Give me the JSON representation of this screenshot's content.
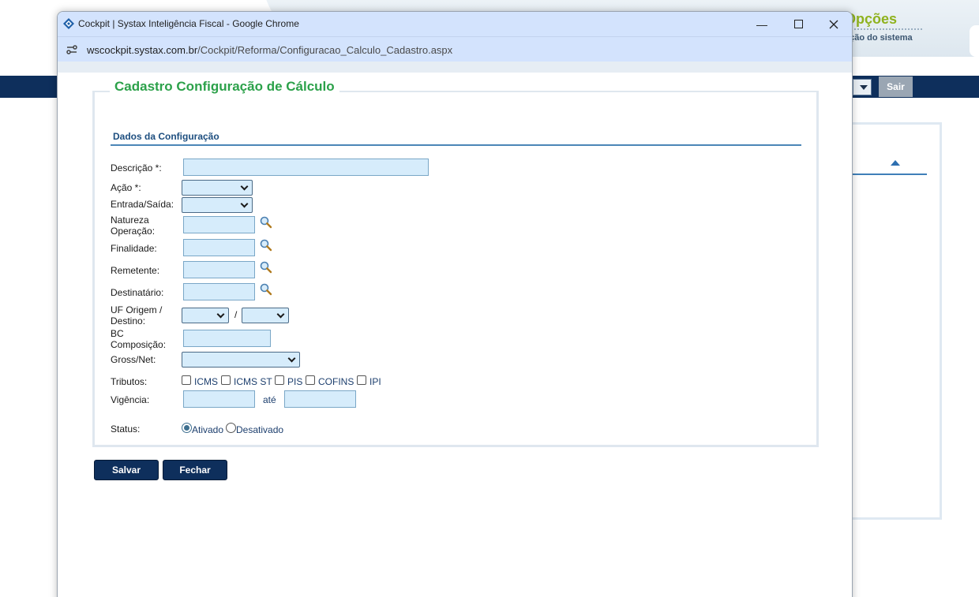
{
  "background": {
    "options_title": "Opções",
    "options_subtitle": "ação do sistema",
    "logout_label": "Sair"
  },
  "window": {
    "title": "Cockpit | Systax Inteligência Fiscal - Google Chrome",
    "url_host": "wscockpit.systax.com.br",
    "url_path": "/Cockpit/Reforma/Configuracao_Calculo_Cadastro.aspx",
    "minimize_glyph": "—",
    "maximize_glyph": "☐",
    "close_glyph": "✕"
  },
  "form": {
    "legend": "Cadastro Configuração de Cálculo",
    "section": "Dados da Configuração",
    "fields": {
      "descricao": {
        "label": "Descrição *:",
        "value": ""
      },
      "acao": {
        "label": "Ação *:",
        "value": ""
      },
      "entrada_saida": {
        "label": "Entrada/Saída:",
        "value": ""
      },
      "natureza_l1": "Natureza",
      "natureza_l2": "Operação:",
      "finalidade": "Finalidade:",
      "remetente": "Remetente:",
      "destinatario": "Destinatário:",
      "uf_l1": "UF Origem /",
      "uf_l2": "Destino:",
      "uf_separator": "/",
      "bc_l1": "BC",
      "bc_l2": "Composição:",
      "gross_net": "Gross/Net:",
      "tributos": "Tributos:",
      "vigencia": "Vigência:",
      "ate": "até",
      "status": "Status:"
    },
    "tributos": [
      {
        "label": "ICMS",
        "checked": false
      },
      {
        "label": "ICMS ST",
        "checked": false
      },
      {
        "label": "PIS",
        "checked": false
      },
      {
        "label": "COFINS",
        "checked": false
      },
      {
        "label": "IPI",
        "checked": false
      }
    ],
    "status_options": [
      {
        "label": "Ativado",
        "selected": true
      },
      {
        "label": "Desativado",
        "selected": false
      }
    ],
    "buttons": {
      "save": "Salvar",
      "close": "Fechar"
    }
  },
  "colors": {
    "accent_green": "#2ca14a",
    "navy": "#0e2f5c",
    "section_blue": "#1d4e7f",
    "input_bg": "#d6ecfb"
  }
}
